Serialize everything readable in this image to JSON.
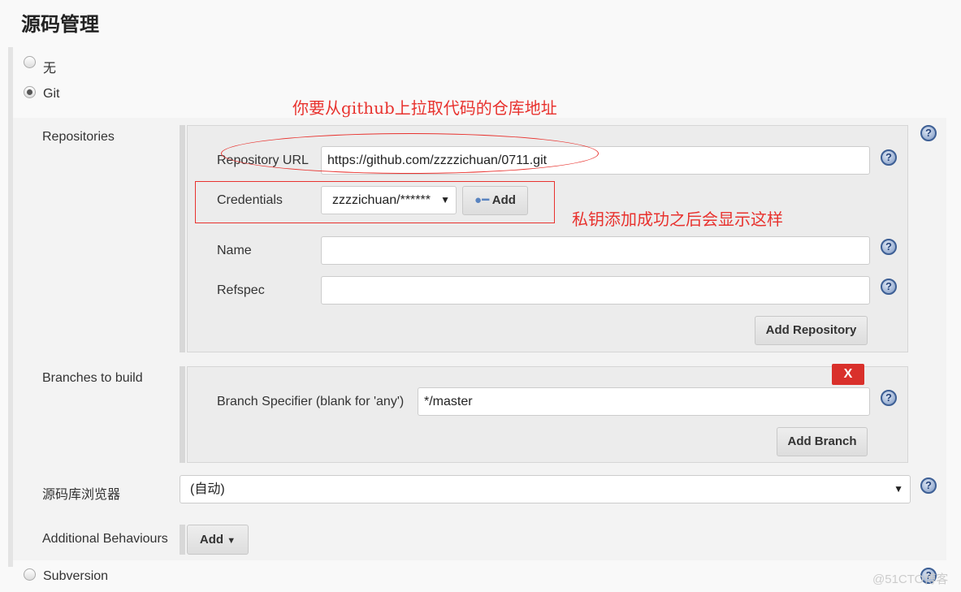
{
  "section_title": "源码管理",
  "scm_options": [
    {
      "label": "无",
      "selected": false
    },
    {
      "label": "Git",
      "selected": true
    },
    {
      "label": "Subversion",
      "selected": false
    }
  ],
  "repositories": {
    "label": "Repositories",
    "url_label": "Repository URL",
    "url_value": "https://github.com/zzzzichuan/0711.git",
    "credentials_label": "Credentials",
    "credentials_value": "zzzzichuan/******",
    "add_label": "Add",
    "name_label": "Name",
    "name_value": "",
    "refspec_label": "Refspec",
    "refspec_value": "",
    "add_repository": "Add Repository"
  },
  "branches": {
    "label": "Branches to build",
    "delete_label": "X",
    "specifier_label": "Branch Specifier (blank for 'any')",
    "specifier_value": "*/master",
    "add_branch": "Add Branch"
  },
  "browser": {
    "label": "源码库浏览器",
    "value": "(自动)"
  },
  "behaviours": {
    "label": "Additional Behaviours",
    "add_label": "Add"
  },
  "annotations": {
    "url_note": "你要从github上拉取代码的仓库地址",
    "cred_note": "私钥添加成功之后会显示这样",
    "color": "#e8322e"
  },
  "watermark": "@51CTO博客",
  "colors": {
    "delete_button": "#d9302b",
    "help_icon": "#3d5f95"
  }
}
